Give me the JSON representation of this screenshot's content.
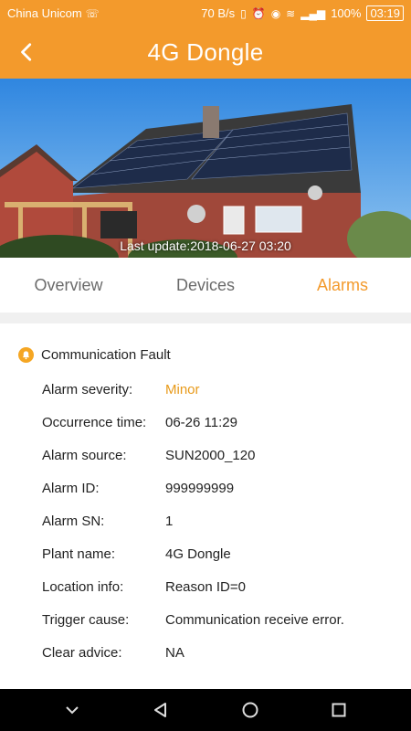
{
  "status_bar": {
    "carrier": "China Unicom",
    "net_speed": "70 B/s",
    "battery": "100%",
    "time": "03:19"
  },
  "header": {
    "title": "4G Dongle"
  },
  "hero": {
    "last_update": "Last update:2018-06-27 03:20"
  },
  "tabs": [
    {
      "label": "Overview"
    },
    {
      "label": "Devices"
    },
    {
      "label": "Alarms"
    }
  ],
  "alarm": {
    "title": "Communication Fault",
    "fields": [
      {
        "key": "Alarm severity:",
        "value": "Minor"
      },
      {
        "key": "Occurrence time:",
        "value": "06-26 11:29"
      },
      {
        "key": "Alarm source:",
        "value": "SUN2000_120"
      },
      {
        "key": "Alarm ID:",
        "value": "999999999"
      },
      {
        "key": "Alarm SN:",
        "value": "1"
      },
      {
        "key": "Plant name:",
        "value": "4G Dongle"
      },
      {
        "key": "Location info:",
        "value": "Reason ID=0"
      },
      {
        "key": "Trigger cause:",
        "value": "Communication receive error."
      },
      {
        "key": "Clear advice:",
        "value": "NA"
      }
    ]
  },
  "colors": {
    "accent": "#f39a2c",
    "severity_minor": "#e89a1a"
  },
  "icons": {
    "back": "chevron-left-icon",
    "alarm": "bell-icon",
    "nav_hide": "chevron-down-icon",
    "nav_back": "triangle-back-icon",
    "nav_home": "circle-home-icon",
    "nav_recent": "square-recent-icon"
  }
}
